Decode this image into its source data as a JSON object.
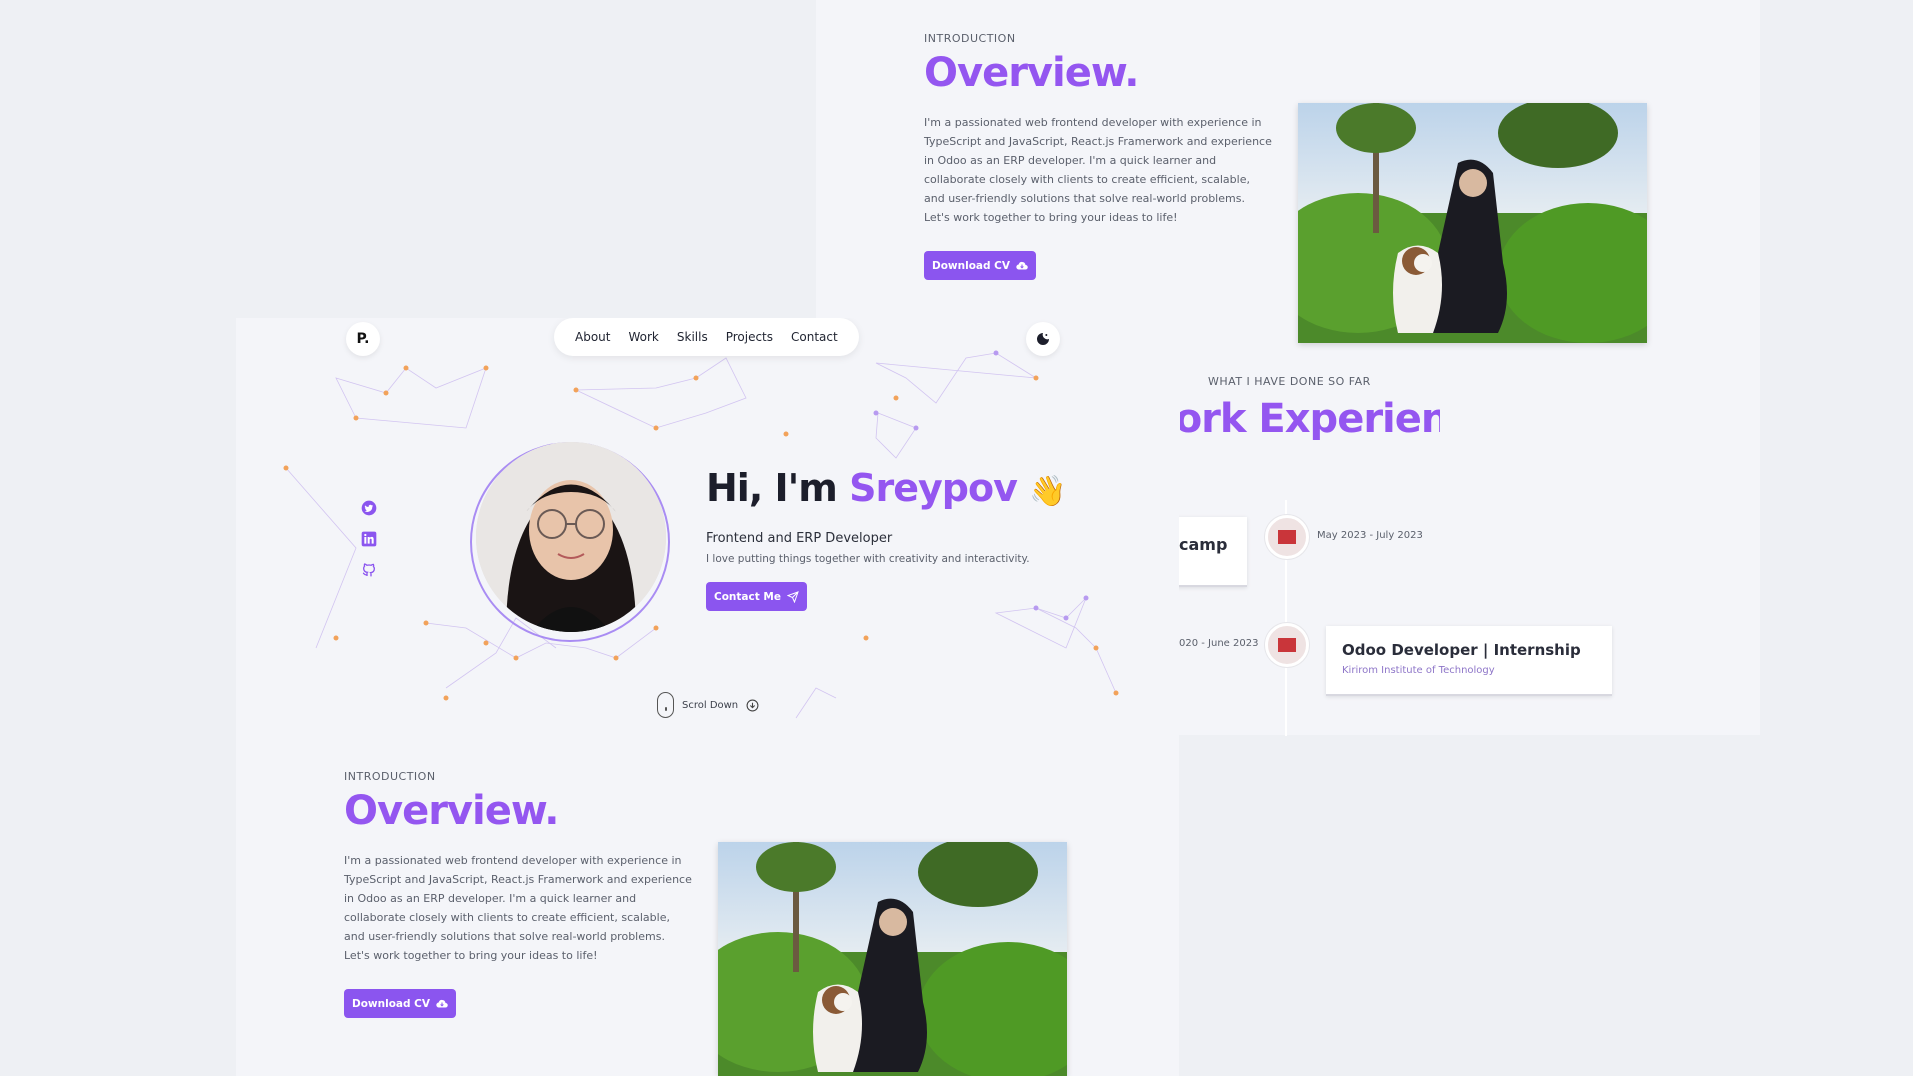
{
  "overview": {
    "eyebrow": "INTRODUCTION",
    "title": "Overview.",
    "paragraph": "I'm a passionated web frontend developer with experience in TypeScript and JavaScript, React.js Framerwork and experience in Odoo as an ERP developer. I'm a quick learner and collaborate closely with clients to create efficient, scalable, and user-friendly solutions that solve real-world problems. Let's work together to bring your ideas to life!",
    "download_label": "Download CV"
  },
  "nav": {
    "logo": "P.",
    "items": [
      "About",
      "Work",
      "Skills",
      "Projects",
      "Contact"
    ]
  },
  "hero": {
    "greeting": "Hi, I'm",
    "name": "Sreypov",
    "wave": "👋",
    "role": "Frontend and ERP Developer",
    "tagline": "I love putting things together with creativity and interactivity.",
    "contact_label": "Contact Me",
    "scroll_label": "Scrol Down"
  },
  "experience": {
    "eyebrow": "WHAT I HAVE DONE SO FAR",
    "title": "Work Experience.",
    "items": [
      {
        "card_title_visible": "camp",
        "date": "May 2023 - July 2023"
      },
      {
        "date_visible": "020 - June 2023",
        "title": "Odoo Developer | Internship",
        "company": "Kirirom Institute of Technology"
      }
    ]
  },
  "colors": {
    "accent": "#9456f0",
    "button": "#8b55ef",
    "background": "#f4f5f9"
  }
}
